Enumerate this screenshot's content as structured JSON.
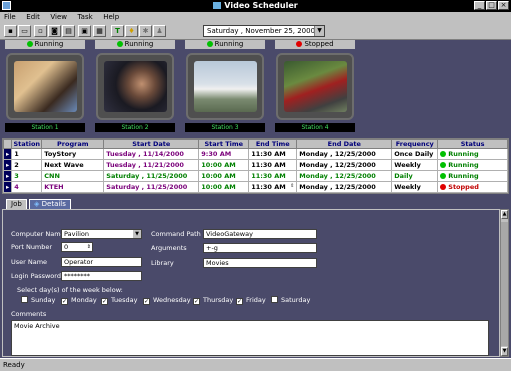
{
  "window": {
    "title": "Video Scheduler"
  },
  "menu": [
    "File",
    "Edit",
    "View",
    "Task",
    "Help"
  ],
  "toolbar": {
    "date_value": "Saturday , November 25, 2000"
  },
  "monitors": [
    {
      "status": "Running",
      "label": "Station 1",
      "status_color": "#00c000"
    },
    {
      "status": "Running",
      "label": "Station 2",
      "status_color": "#00c000"
    },
    {
      "status": "Running",
      "label": "Station 3",
      "status_color": "#00c000"
    },
    {
      "status": "Stopped",
      "label": "Station 4",
      "status_color": "#e00000"
    }
  ],
  "grid": {
    "headers": [
      "Station",
      "Program",
      "Start Date",
      "Start Time",
      "End Time",
      "End Date",
      "Frequency",
      "Status"
    ],
    "rows": [
      {
        "station": "1",
        "program": "ToyStory",
        "start_date": "Tuesday , 11/14/2000",
        "start_time": "9:30 AM",
        "end_time": "11:30 AM",
        "end_date": "Monday , 12/25/2000",
        "frequency": "Once Daily",
        "status": "Running"
      },
      {
        "station": "2",
        "program": "Next Wave",
        "start_date": "Tuesday , 11/21/2000",
        "start_time": "10:00 AM",
        "end_time": "11:30 AM",
        "end_date": "Monday , 12/25/2000",
        "frequency": "Weekly",
        "status": "Running"
      },
      {
        "station": "3",
        "program": "CNN",
        "start_date": "Saturday , 11/25/2000",
        "start_time": "10:00 AM",
        "end_time": "11:30 AM",
        "end_date": "Monday , 12/25/2000",
        "frequency": "Daily",
        "status": "Running"
      },
      {
        "station": "4",
        "program": "KTEH",
        "start_date": "Saturday , 11/25/2000",
        "start_time": "10:00 AM",
        "end_time": "11:30 AM",
        "end_date": "Monday , 12/25/2000",
        "frequency": "Weekly",
        "status": "Stopped"
      }
    ]
  },
  "tabs": [
    "Job",
    "Details"
  ],
  "job": {
    "computer_name_label": "Computer Name",
    "computer_name_value": "Pavilion",
    "port_number_label": "Port Number",
    "port_number_value": "0",
    "user_name_label": "User Name",
    "user_name_value": "Operator",
    "login_password_label": "Login Password",
    "login_password_value": "********",
    "command_path_label": "Command Path",
    "command_path_value": "VideoGateway",
    "arguments_label": "Arguments",
    "arguments_value": "+-g",
    "library_label": "Library",
    "library_value": "Movies",
    "days_label": "Select day(s) of the week below:",
    "days": [
      {
        "name": "Sunday",
        "checked": false
      },
      {
        "name": "Monday",
        "checked": true
      },
      {
        "name": "Tuesday",
        "checked": true
      },
      {
        "name": "Wednesday",
        "checked": true
      },
      {
        "name": "Thursday",
        "checked": true
      },
      {
        "name": "Friday",
        "checked": true
      },
      {
        "name": "Saturday",
        "checked": false
      }
    ],
    "comments_label": "Comments",
    "comments_value": "Movie Archive"
  },
  "status_bar": "Ready"
}
